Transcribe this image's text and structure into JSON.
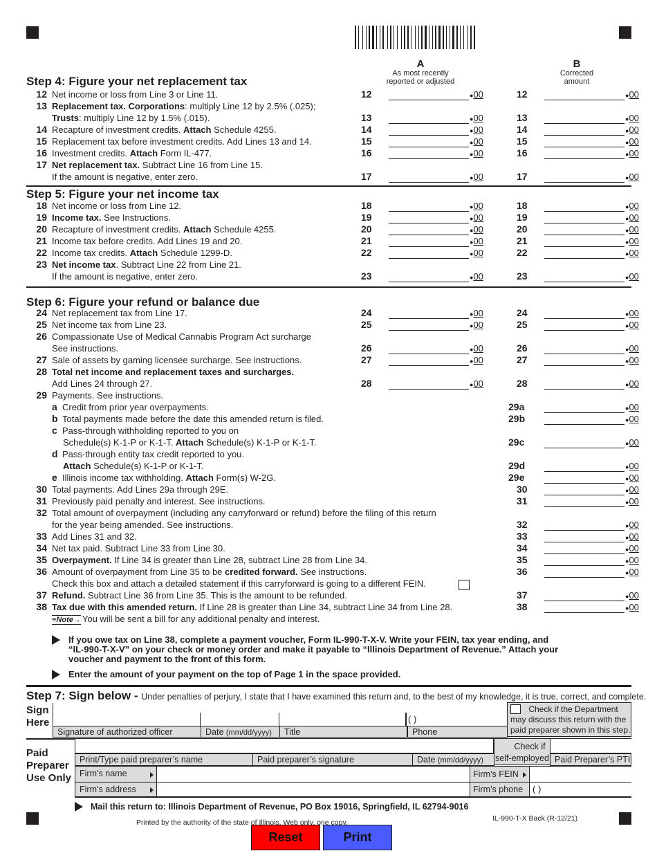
{
  "columns": {
    "a": {
      "letter": "A",
      "line1": "As most recently",
      "line2": "reported or adjusted"
    },
    "b": {
      "letter": "B",
      "line1": "Corrected",
      "line2": "amount"
    }
  },
  "cents_label": "00",
  "steps": {
    "step4": {
      "title": "Step 4:  Figure your net replacement tax",
      "lines": [
        {
          "num": "12",
          "text": "Net income or loss from Line 3 or Line 11."
        },
        {
          "num": "13",
          "bold": "Replacement tax. Corporations",
          "text": ": multiply Line 12 by 2.5% (.025);",
          "cont_bold": "Trusts",
          "cont": ": multiply Line 12 by 1.5% (.015)."
        },
        {
          "num": "14",
          "text": "Recapture of investment credits. ",
          "bold2": "Attach",
          "text2": " Schedule 4255."
        },
        {
          "num": "15",
          "text": "Replacement tax before investment credits. Add Lines 13 and 14."
        },
        {
          "num": "16",
          "text": "Investment credits. ",
          "bold2": "Attach",
          "text2": " Form IL-477."
        },
        {
          "num": "17",
          "bold": "Net replacement tax.",
          "text": " Subtract Line 16 from Line 15.",
          "cont": "If the amount is negative, enter zero."
        }
      ]
    },
    "step5": {
      "title": "Step 5:  Figure your net income tax",
      "lines": [
        {
          "num": "18",
          "text": "Net income or loss from Line 12."
        },
        {
          "num": "19",
          "bold": "Income tax.",
          "text": " See Instructions."
        },
        {
          "num": "20",
          "text": "Recapture of investment credits. ",
          "bold2": "Attach",
          "text2": " Schedule 4255."
        },
        {
          "num": "21",
          "text": "Income tax before credits. Add Lines 19 and 20."
        },
        {
          "num": "22",
          "text": "Income tax credits. ",
          "bold2": "Attach",
          "text2": " Schedule 1299-D."
        },
        {
          "num": "23",
          "bold": "Net income tax",
          "text": ". Subtract Line 22 from Line 21.",
          "cont": "If the amount is negative, enter zero."
        }
      ]
    },
    "step6": {
      "title": "Step 6:  Figure your refund or balance due",
      "lines": [
        {
          "num": "24",
          "text": "Net replacement tax from Line 17."
        },
        {
          "num": "25",
          "text": "Net income tax from Line 23."
        },
        {
          "num": "26",
          "text": "Compassionate Use of Medical Cannabis Program Act surcharge",
          "cont": "See instructions."
        },
        {
          "num": "27",
          "text": "Sale of assets by gaming licensee surcharge. See instructions."
        },
        {
          "num": "28",
          "bold": "Total net income and replacement taxes and surcharges.",
          "cont": "Add Lines 24 through 27."
        },
        {
          "num": "29",
          "text": "Payments. See instructions."
        },
        {
          "sub": "a",
          "text": "Credit from prior year overpayments."
        },
        {
          "sub": "b",
          "text": "Total payments made before the date this amended return is filed."
        },
        {
          "sub": "c",
          "text": "Pass-through withholding reported to you on",
          "cont": "Schedule(s) K-1-P or K-1-T. ",
          "cont_bold2": "Attach",
          "cont2": " Schedule(s) K-1-P or K-1-T."
        },
        {
          "sub": "d",
          "text": "Pass-through entity tax credit reported to you.",
          "cont_bold": "Attach",
          "cont": " Schedule(s) K-1-P or K-1-T."
        },
        {
          "sub": "e",
          "text": "Illinois income tax withholding. ",
          "bold2": "Attach",
          "text2": " Form(s) W-2G."
        },
        {
          "num": "30",
          "text": "Total payments. Add Lines 29a through 29E."
        },
        {
          "num": "31",
          "text": "Previously paid penalty and interest. See instructions."
        },
        {
          "num": "32",
          "text": "Total amount of overpayment (including any carryforward or refund) before the filing of this return",
          "cont": "for the year being amended. See instructions."
        },
        {
          "num": "33",
          "text": "Add Lines 31 and 32."
        },
        {
          "num": "34",
          "text": "Net tax paid. Subtract Line 33 from Line 30."
        },
        {
          "num": "35",
          "bold": "Overpayment.",
          "text": " If Line 34 is greater than Line 28, subtract Line 28 from Line 34."
        },
        {
          "num": "36",
          "text": "Amount of overpayment from Line 35 to be ",
          "bold2": "credited forward.",
          "text2": " See instructions.",
          "cont": "Check this box and attach a detailed statement if this carryforward is going to a different FEIN."
        },
        {
          "num": "37",
          "bold": "Refund.",
          "text": " Subtract Line 36 from Line 35. This is the amount to be refunded."
        },
        {
          "num": "38",
          "bold": "Tax due with this amended return.",
          "text": " If Line 28 is greater than Line 34, subtract Line 34 from Line 28.",
          "note_tag": "Note",
          "cont": "You will be sent a bill for any additional penalty and interest."
        }
      ]
    }
  },
  "amount_labels": {
    "col_a": [
      "12",
      "13",
      "14",
      "15",
      "16",
      "17",
      "18",
      "19",
      "20",
      "21",
      "22",
      "23",
      "24",
      "25",
      "26",
      "27",
      "28"
    ],
    "col_b": [
      "12",
      "13",
      "14",
      "15",
      "16",
      "17",
      "18",
      "19",
      "20",
      "21",
      "22",
      "23",
      "24",
      "25",
      "26",
      "27",
      "28",
      "29a",
      "29b",
      "29c",
      "29d",
      "29e",
      "30",
      "31",
      "32",
      "33",
      "34",
      "35",
      "36",
      "37",
      "38"
    ]
  },
  "instructions": {
    "bullet1_line1": "If you owe tax on Line 38, complete a payment voucher, Form IL-990-T-X-V.  Write your FEIN, tax year ending, and",
    "bullet1_line2": "“IL-990-T-X-V” on your check or money order and make it payable to “Illinois Department of Revenue.” Attach your",
    "bullet1_line3": "voucher and payment to the front of this form.",
    "bullet2": "Enter the amount of your payment on the top of Page 1 in the space provided."
  },
  "step7": {
    "title_a": "Step 7",
    "title_b": ":  Sign below - ",
    "perjury": "Under penalties of perjury, I state that I have examined this return and, to the best of my knowledge, it is true, correct, and complete.",
    "sign_here_1": "Sign",
    "sign_here_2": "Here",
    "signature_label": "Signature of authorized officer",
    "date_label": "Date",
    "date_format": "(mm/dd/yyyy)",
    "title_label": "Title",
    "phone_label": "Phone",
    "phone_parens": "(      )",
    "discuss_line1": "Check if the Department",
    "discuss_line2": "may discuss this return with the",
    "discuss_line3": "paid preparer shown in this step.",
    "preparer_1": "Paid",
    "preparer_2": "Preparer",
    "preparer_3": "Use Only",
    "preparer_name_label": "Print/Type paid preparer’s name",
    "preparer_sig_label": "Paid preparer’s signature",
    "self_employed_1": "Check if",
    "self_employed_2": "self-employed",
    "ptin_label": "Paid Preparer’s PTIN",
    "firm_name_label": "Firm’s name",
    "firm_address_label": "Firm’s address",
    "firm_fein_label": "Firm’s FEIN",
    "firm_phone_label": "Firm’s phone",
    "firm_phone_parens": "(        )"
  },
  "footer": {
    "mail_to": "Mail this return to: Illinois Department of Revenue, PO Box 19016, Springfield, IL  62794-9016",
    "printed_by": "Printed by the authority of the state of Illinois. Web only, one copy.",
    "form_id": "IL-990-T-X Back (R-12/21)"
  },
  "buttons": {
    "reset": "Reset",
    "print": "Print",
    "reset_color": "#ff0000",
    "print_color": "#4a5cff"
  }
}
